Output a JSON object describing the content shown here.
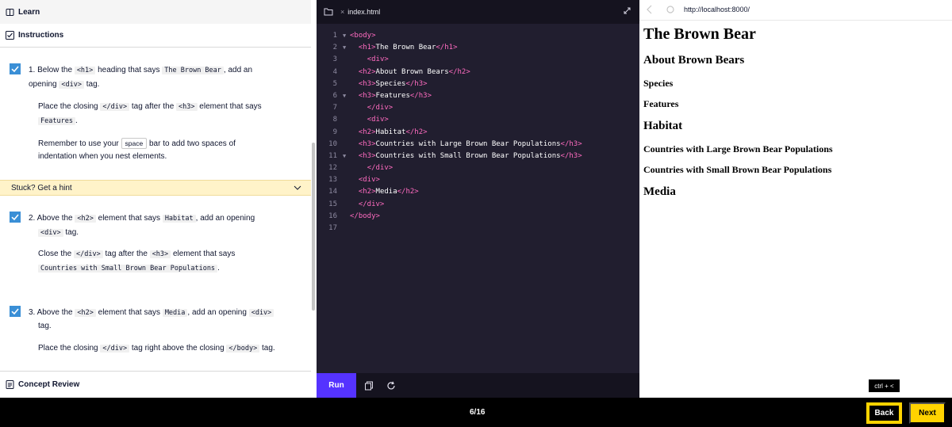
{
  "left": {
    "learn_label": "Learn",
    "instructions_label": "Instructions",
    "concept_label": "Concept Review",
    "tasks": [
      {
        "p1": [
          "1. Below the ",
          "<h1>",
          " heading that says ",
          "The Brown Bear",
          ", add an"
        ],
        "p1b": [
          "opening ",
          "<div>",
          " tag."
        ],
        "p2": [
          "Place the closing ",
          "</div>",
          " tag after the ",
          "<h3>",
          " element that says"
        ],
        "p2b": [
          "Features",
          "."
        ],
        "p3": [
          "Remember to use your ",
          "space",
          " bar to add two spaces of"
        ],
        "p3b": "indentation when you nest elements."
      },
      {
        "p1": [
          "2. Above the ",
          "<h2>",
          " element that says ",
          "Habitat",
          ", add an opening"
        ],
        "p1b": [
          "<div>",
          " tag."
        ],
        "p2": [
          "Close the ",
          "</div>",
          " tag after the ",
          "<h3>",
          " element that says"
        ],
        "p2b": [
          "Countries with Small Brown Bear Populations",
          "."
        ]
      },
      {
        "p1": [
          "3. Above the ",
          "<h2>",
          " element that says ",
          "Media",
          ", add an opening ",
          "<div>"
        ],
        "p1b": "tag.",
        "p2": [
          "Place the closing ",
          "</div>",
          " tag right above the closing ",
          "</body>",
          " tag."
        ]
      }
    ],
    "hint_label": "Stuck? Get a hint"
  },
  "editor": {
    "tab_name": "index.html",
    "run_label": "Run",
    "lines": [
      {
        "n": "1",
        "fold": "▼",
        "indent": "",
        "open": "<body>",
        "text": "",
        "close": ""
      },
      {
        "n": "2",
        "fold": "▼",
        "indent": "  ",
        "open": "<h1>",
        "text": "The Brown Bear",
        "close": "</h1>"
      },
      {
        "n": "3",
        "fold": "",
        "indent": "    ",
        "open": "<div>",
        "text": "",
        "close": ""
      },
      {
        "n": "4",
        "fold": "",
        "indent": "  ",
        "open": "<h2>",
        "text": "About Brown Bears",
        "close": "</h2>"
      },
      {
        "n": "5",
        "fold": "",
        "indent": "  ",
        "open": "<h3>",
        "text": "Species",
        "close": "</h3>"
      },
      {
        "n": "6",
        "fold": "▼",
        "indent": "  ",
        "open": "<h3>",
        "text": "Features",
        "close": "</h3>"
      },
      {
        "n": "7",
        "fold": "",
        "indent": "    ",
        "open": "</div>",
        "text": "",
        "close": ""
      },
      {
        "n": "8",
        "fold": "",
        "indent": "    ",
        "open": "<div>",
        "text": "",
        "close": ""
      },
      {
        "n": "9",
        "fold": "",
        "indent": "  ",
        "open": "<h2>",
        "text": "Habitat",
        "close": "</h2>"
      },
      {
        "n": "10",
        "fold": "",
        "indent": "  ",
        "open": "<h3>",
        "text": "Countries with Large Brown Bear Populations",
        "close": "</h3>"
      },
      {
        "n": "11",
        "fold": "▼",
        "indent": "  ",
        "open": "<h3>",
        "text": "Countries with Small Brown Bear Populations",
        "close": "</h3>"
      },
      {
        "n": "12",
        "fold": "",
        "indent": "    ",
        "open": "</div>",
        "text": "",
        "close": ""
      },
      {
        "n": "13",
        "fold": "",
        "indent": "  ",
        "open": "<div>",
        "text": "",
        "close": ""
      },
      {
        "n": "14",
        "fold": "",
        "indent": "  ",
        "open": "<h2>",
        "text": "Media",
        "close": "</h2>"
      },
      {
        "n": "15",
        "fold": "",
        "indent": "  ",
        "open": "</div>",
        "text": "",
        "close": ""
      },
      {
        "n": "16",
        "fold": "",
        "indent": "",
        "open": "</body>",
        "text": "",
        "close": ""
      },
      {
        "n": "17",
        "fold": "",
        "indent": "",
        "open": "",
        "text": "",
        "close": ""
      }
    ]
  },
  "browser": {
    "url": "http://localhost:8000/",
    "preview": {
      "h1": "The Brown Bear",
      "about": "About Brown Bears",
      "species": "Species",
      "features": "Features",
      "habitat": "Habitat",
      "large": "Countries with Large Brown Bear Populations",
      "small": "Countries with Small Brown Bear Populations",
      "media": "Media"
    }
  },
  "tooltip": "ctrl + <",
  "bottom": {
    "progress": "6/16",
    "back_label": "Back",
    "next_label": "Next"
  },
  "colors": {
    "check": "#3a8fd6",
    "run": "#5533ff",
    "next": "#ffd300",
    "tag": "#ff6bc0",
    "editor_bg": "#211e2f"
  }
}
